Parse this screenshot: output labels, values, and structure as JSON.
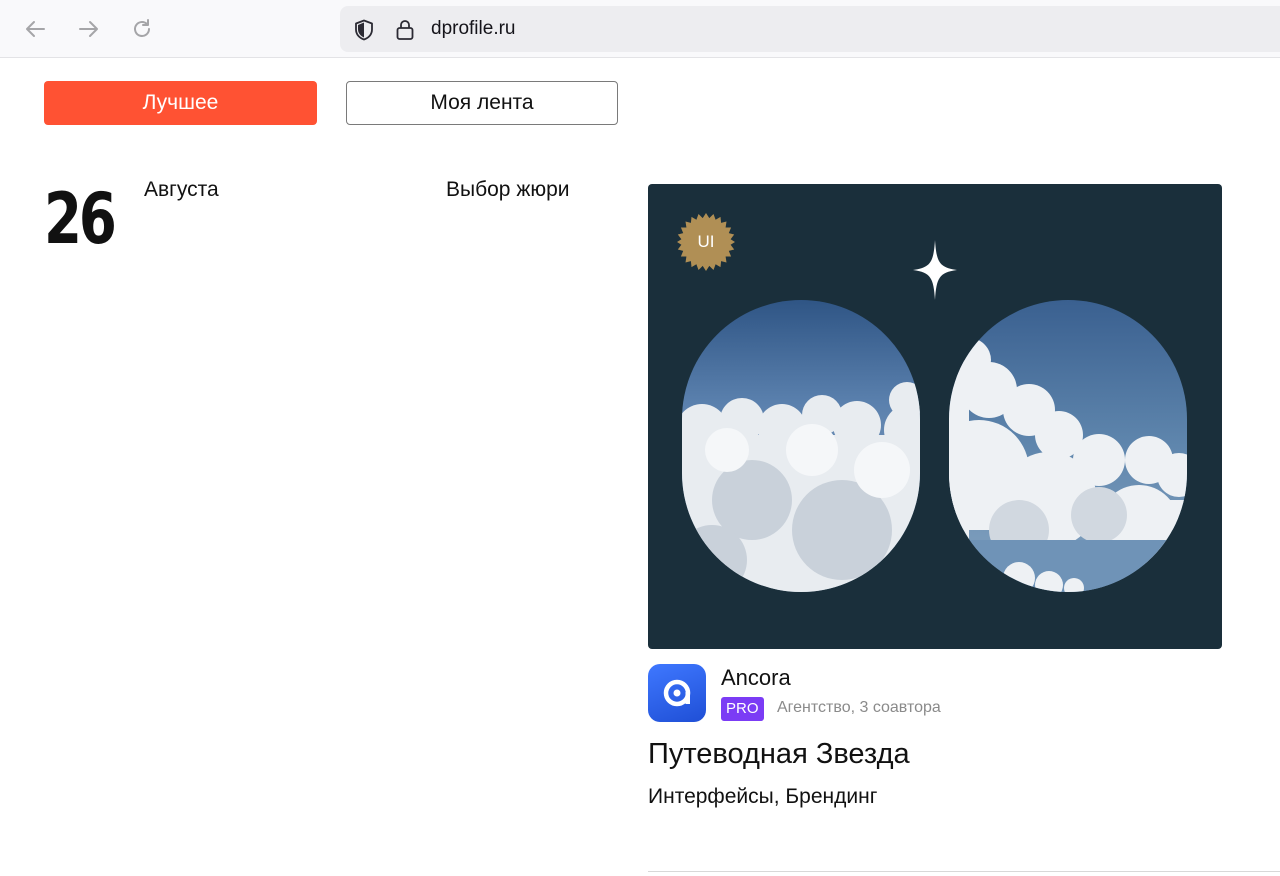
{
  "browser": {
    "url": "dprofile.ru",
    "icons": {
      "back": "arrow-left-icon",
      "forward": "arrow-right-icon",
      "reload": "reload-icon",
      "shield": "shield-icon",
      "lock": "lock-icon"
    }
  },
  "filters": {
    "best_label": "Лучшее",
    "feed_label": "Моя лента",
    "active": "best",
    "accent_color": "#ff5233"
  },
  "date": {
    "day": "26",
    "month": "Августа"
  },
  "section_label": "Выбор жюри",
  "project": {
    "badge": "UI",
    "author": "Ancora",
    "author_badge": "PRO",
    "author_meta": "Агентство, 3 соавтора",
    "title": "Путеводная Звезда",
    "categories": "Интерфейсы, Брендинг",
    "cover_color": "#1a2f3b"
  }
}
